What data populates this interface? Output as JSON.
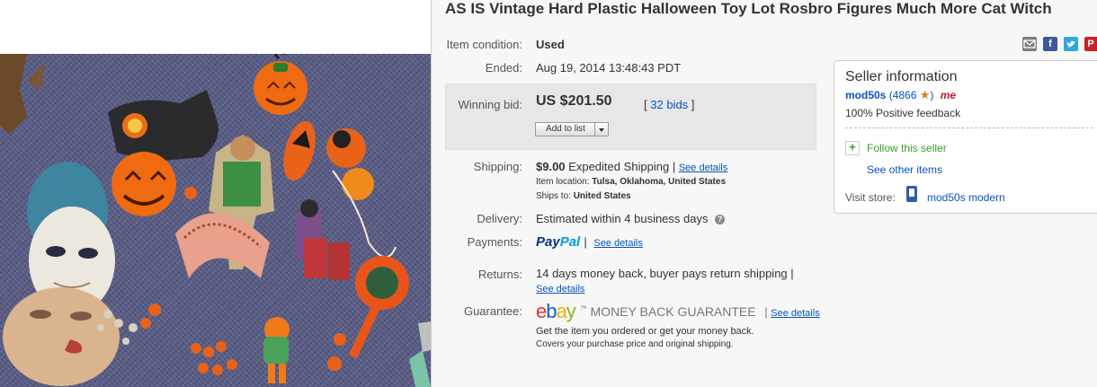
{
  "title": "AS IS Vintage Hard Plastic Halloween Toy Lot Rosbro Figures Much More Cat Witch",
  "details": {
    "condition_label": "Item condition:",
    "condition_value": "Used",
    "ended_label": "Ended:",
    "ended_value": "Aug 19, 2014  13:48:43 PDT",
    "winning_bid_label": "Winning bid:",
    "winning_bid_value": "US $201.50",
    "bids_link": "32 bids",
    "bids_open": "[",
    "bids_close": "]",
    "add_to_list": "Add to list",
    "shipping_label": "Shipping:",
    "shipping_price": "$9.00",
    "shipping_method": "Expedited Shipping |",
    "see_details": "See details",
    "item_location_label": "Item location:",
    "item_location": "Tulsa, Oklahoma, United States",
    "ships_to_label": "Ships to:",
    "ships_to": "United States",
    "delivery_label": "Delivery:",
    "delivery_value": "Estimated within 4 business days",
    "payments_label": "Payments:",
    "paypal_pay": "Pay",
    "paypal_pal": "Pal",
    "pipe": "|",
    "returns_label": "Returns:",
    "returns_value": "14 days money back, buyer pays return shipping |",
    "guarantee_label": "Guarantee:",
    "ebay_logo": "ebay",
    "ebay_tm": "™",
    "money_back": "MONEY BACK GUARANTEE",
    "guarantee_line1": "Get the item you ordered or get your money back.",
    "guarantee_line2": "Covers your purchase price and original shipping."
  },
  "seller": {
    "heading": "Seller information",
    "name": "mod50s",
    "feedback_open": "(",
    "feedback_count": "4866",
    "feedback_close": ")",
    "me_badge": "me",
    "positive": "100% Positive feedback",
    "follow": "Follow this seller",
    "see_other": "See other items",
    "visit_store_label": "Visit store:",
    "store_name": "mod50s modern"
  },
  "share_icons": [
    "email-icon",
    "facebook-icon",
    "twitter-icon",
    "pinterest-icon"
  ],
  "colors": {
    "link": "#0654ba",
    "star": "#e07b24",
    "follow_green": "#3a9e2e",
    "ebay_red": "#e53238",
    "ebay_blue": "#0064d2",
    "ebay_yellow": "#f5af02",
    "ebay_green": "#86b817",
    "paypal_dark": "#003087",
    "paypal_light": "#009cde"
  }
}
